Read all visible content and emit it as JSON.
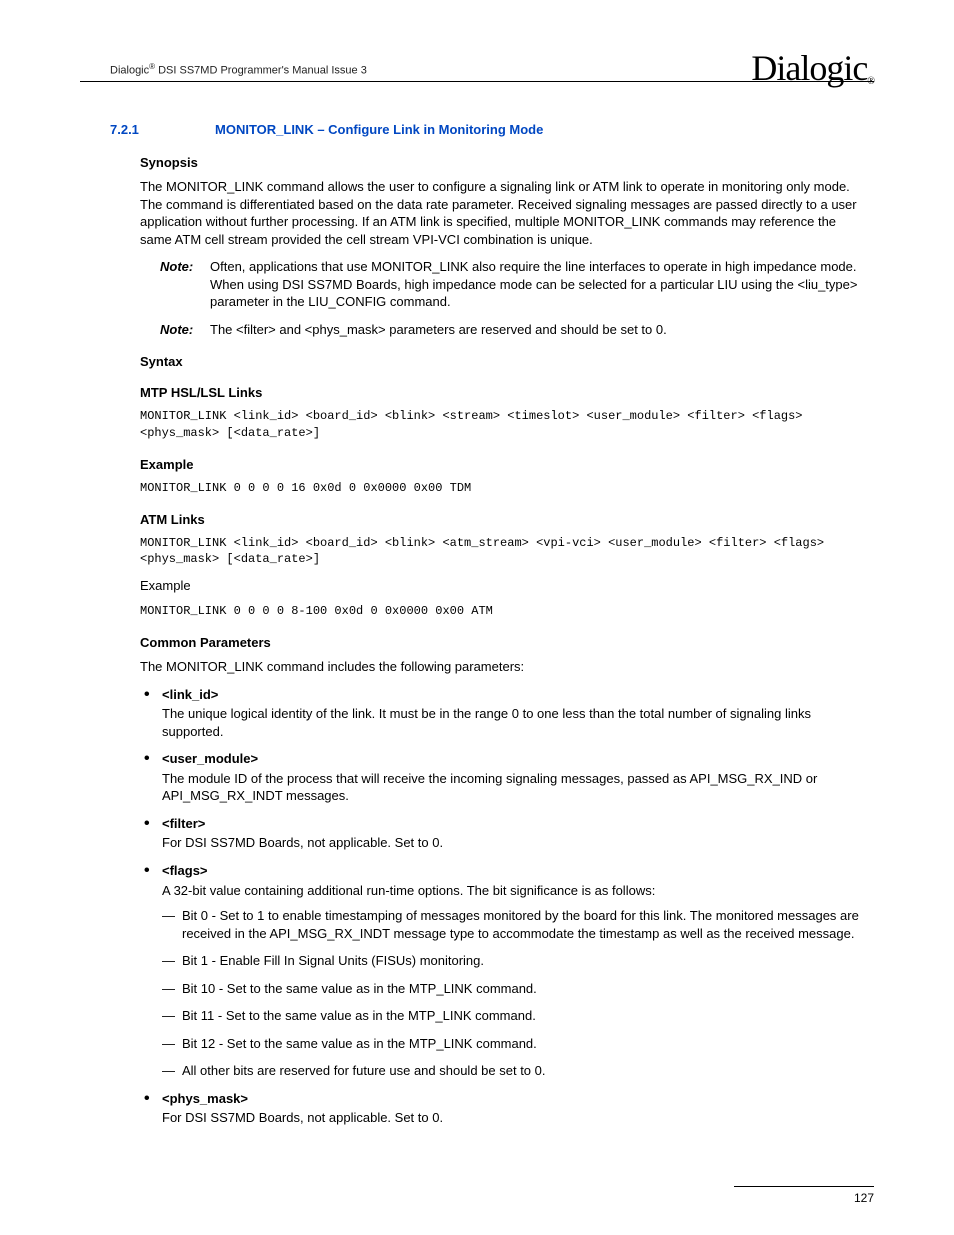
{
  "header": {
    "doc_title_prefix": "Dialogic",
    "doc_title_suffix": " DSI SS7MD Programmer's Manual  Issue 3",
    "logo_text": "Dialogic",
    "logo_reg": "®"
  },
  "section": {
    "number": "7.2.1",
    "title": "MONITOR_LINK  – Configure Link in Monitoring Mode"
  },
  "synopsis": {
    "heading": "Synopsis",
    "text": "The MONITOR_LINK command allows the user to configure a signaling link or ATM link to operate in monitoring only mode. The command is differentiated based on the data rate parameter. Received signaling messages are passed directly to a user application without further processing. If an ATM link is specified, multiple MONITOR_LINK commands may reference the same ATM cell stream provided the cell stream VPI-VCI combination is unique."
  },
  "notes": {
    "label": "Note:",
    "note1": "Often, applications that use MONITOR_LINK also require the line interfaces to operate in high impedance mode. When using DSI SS7MD Boards, high impedance mode can be selected for a particular LIU using the <liu_type> parameter in the LIU_CONFIG command.",
    "note2": "The <filter> and <phys_mask> parameters are reserved and should be set to 0."
  },
  "syntax": {
    "heading": "Syntax"
  },
  "mtp": {
    "heading": "MTP HSL/LSL Links",
    "code": "MONITOR_LINK <link_id> <board_id> <blink> <stream> <timeslot> <user_module> <filter> <flags> <phys_mask> [<data_rate>]"
  },
  "example1": {
    "heading": "Example",
    "code": "MONITOR_LINK 0 0 0 0 16 0x0d 0 0x0000 0x00 TDM"
  },
  "atm": {
    "heading": "ATM Links",
    "code": "MONITOR_LINK <link_id> <board_id> <blink> <atm_stream> <vpi-vci> <user_module> <filter> <flags> <phys_mask> [<data_rate>]"
  },
  "example2": {
    "heading": "Example",
    "code": "MONITOR_LINK 0 0 0 0 8-100 0x0d 0 0x0000 0x00 ATM"
  },
  "common": {
    "heading": "Common Parameters",
    "intro": "The MONITOR_LINK command includes the following parameters:"
  },
  "params": {
    "link_id": {
      "name": "<link_id>",
      "desc": "The unique logical identity of the link. It must be in the range 0 to one less than the total number of signaling links supported."
    },
    "user_module": {
      "name": "<user_module>",
      "desc": "The module ID of the process that will receive the incoming signaling messages, passed as API_MSG_RX_IND or API_MSG_RX_INDT messages."
    },
    "filter": {
      "name": "<filter>",
      "desc": "For DSI SS7MD Boards, not applicable. Set to 0."
    },
    "flags": {
      "name": "<flags>",
      "desc": "A 32-bit value containing additional run-time options. The bit significance is as follows:",
      "bits": {
        "b0": "Bit 0 - Set to 1 to enable timestamping of messages monitored by the board for this link. The monitored messages are received in the API_MSG_RX_INDT message type to accommodate the timestamp as well as the received message.",
        "b1": "Bit 1 - Enable Fill In Signal Units (FISUs) monitoring.",
        "b10": "Bit 10 - Set to the same value as in the MTP_LINK command.",
        "b11": "Bit 11 - Set to the same value as in the MTP_LINK command.",
        "b12": "Bit 12 - Set to the same value as in the MTP_LINK command.",
        "other": "All other bits are reserved for future use and should be set to 0."
      }
    },
    "phys_mask": {
      "name": "<phys_mask>",
      "desc": "For DSI SS7MD Boards, not applicable. Set to 0."
    }
  },
  "footer": {
    "page": "127"
  }
}
